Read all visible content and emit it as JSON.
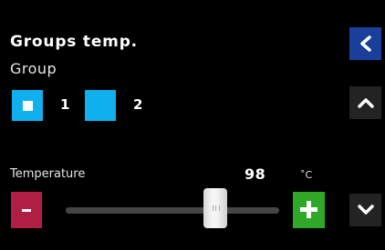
{
  "screen": {
    "title": "Groups temp.",
    "group_label": "Group",
    "groups": [
      {
        "number": "1",
        "selected": true
      },
      {
        "number": "2",
        "selected": false
      }
    ]
  },
  "temperature": {
    "label": "Temperature",
    "value": "98",
    "unit": "˚C",
    "slider_level_fraction": 0.7
  },
  "icons": {
    "back": "chevron-left-icon",
    "up": "chevron-up-icon",
    "down": "chevron-down-icon",
    "decrease": "minus-icon",
    "increase": "plus-icon"
  },
  "colors": {
    "background": "#000000",
    "group_button": "#10b0ee",
    "back_button": "#1a3f9a",
    "nav_button": "#232323",
    "decrease_button": "#b01f43",
    "increase_button": "#2fa827",
    "slider_track": "#454545"
  }
}
